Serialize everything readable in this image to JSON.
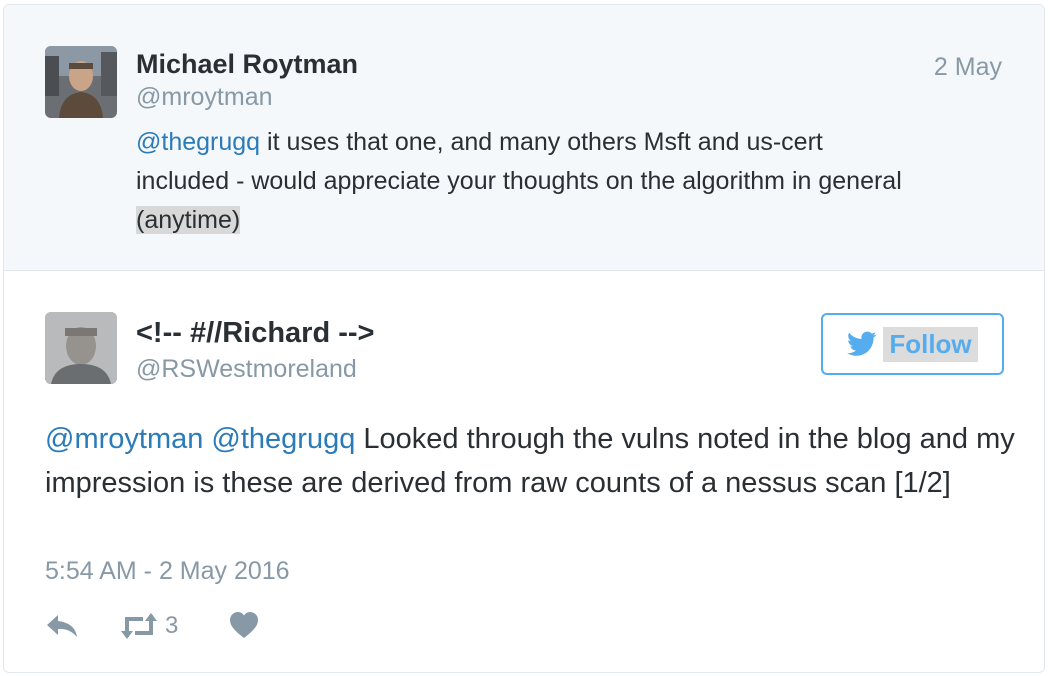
{
  "parent_tweet": {
    "name": "Michael Roytman",
    "handle": "@mroytman",
    "date": "2 May",
    "mention": "@thegrugq",
    "text_line1": " it uses that one, and many others Msft and us-cert",
    "text_line2": "included - would appreciate your thoughts on the algorithm in general",
    "text_highlight": "(anytime)"
  },
  "tweet": {
    "name": "<!-- #//Richard -->",
    "handle": "@RSWestmoreland",
    "follow_label": "Follow",
    "mention1": "@mroytman",
    "mention2": "@thegrugq",
    "text": " Looked through the vulns noted in the blog and my impression is these are derived from raw counts of a nessus scan [1/2]",
    "timestamp": "5:54 AM - 2 May 2016",
    "retweet_count": "3"
  },
  "icons": {
    "reply": "reply-icon",
    "retweet": "retweet-icon",
    "like": "heart-icon",
    "follow_bird": "twitter-bird-icon"
  },
  "colors": {
    "link": "#2b7bb9",
    "follow": "#55acee",
    "muted": "#8899a6",
    "action_icon": "#8899a6"
  }
}
